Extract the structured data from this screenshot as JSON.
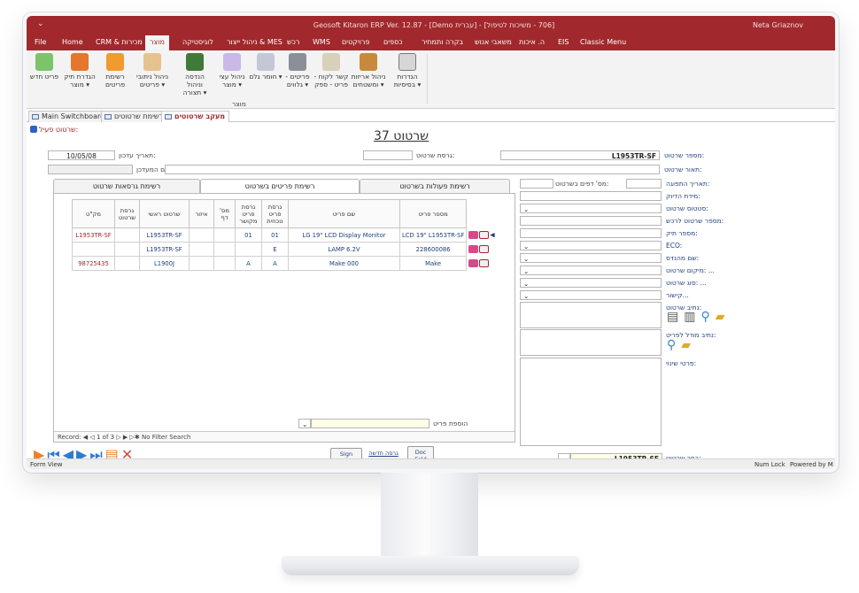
{
  "window": {
    "title": "Geosoft Kitaron ERP Ver. 12.87 - [Demo עברית] - [706 - משיכות לטיפול]",
    "user": "Neta Griaznov",
    "quick_access": "⌄"
  },
  "menu": [
    "File",
    "Home",
    "CRM & מכירות",
    "מוצר",
    "לוגיסטיקה",
    "ניהול ייצור & MES",
    "רכש",
    "WMS",
    "פרויקטים",
    "כספים",
    "בקרה ותמחיר",
    "משאבי אנוש",
    "ה. איכות",
    "EIS",
    "Classic Menu"
  ],
  "menu_active": "מוצר",
  "ribbon": {
    "buttons": [
      {
        "label": "פריט חדש"
      },
      {
        "label": "הגדרת תיק מוצר ▾"
      },
      {
        "label": "רשימת פריטים"
      },
      {
        "label": "ניהול ניתובי פריטים ▾"
      },
      {
        "label": "הנדסה וניהול תצורה ▾"
      },
      {
        "label": "ניהול עצי מוצר ▾"
      },
      {
        "label": "חומר גלם ▾"
      },
      {
        "label": "פריטים - גלווים ▾"
      },
      {
        "label": "קשר לקוח - פריט - ספק"
      },
      {
        "label": "ניהול אריזות ומשטחים ▾"
      },
      {
        "label": "הגדרות בסיסיות ▾"
      }
    ],
    "group_label": "מוצר"
  },
  "doc_tabs": [
    "Main Switchboard",
    "רשימת שרטוטים",
    "מעקב שרטוטים"
  ],
  "form": {
    "title": "שרטוט 37",
    "active_label": "שרטוט פעיל:",
    "update_date_label": "תאריך עדכון:",
    "update_date": "10/05/08",
    "updater_label": "שם המעדכן:",
    "updater": "",
    "version_label": "גרסת שרטוט:",
    "version": "",
    "drawing_no_label": "מספר שרטוט:",
    "drawing_no": "L1953TR-SF",
    "description_label": "תאור שרטוט:",
    "description": "",
    "right_labels": [
      "תאריך התפוגה:",
      "מידת הדיוק:",
      "סטטוס שרטוט:",
      "מספר שרטוט לרכש:",
      "מספר תיק:",
      "ECO:",
      "שם מהנדס:",
      "מיקום שרטוט: ...",
      "סוג שרטוט: ...",
      "קישור..."
    ],
    "pages_label": "מס' דפים בשרטוט:",
    "path_label": "נתיב שרטוט:",
    "model_path_label": "נתיב מודל לפריט:",
    "change_details_label": "פרטי שינוי:",
    "select_drawing_label": "בחר שרטוט:",
    "select_drawing_value": "L1953TR-SF"
  },
  "grid_tabs": [
    "רשימת גרסאות שרטוט",
    "רשימת פריטים בשרטוט",
    "רשימת פעולות בשרטוט"
  ],
  "grid_tab_active": "רשימת פריטים בשרטוט",
  "grid": {
    "headers": [
      "מק\"ט",
      "גרסת שרטוט",
      "שרטוט ראשי",
      "איזור",
      "מס' דף",
      "גרסת פריט מקושר",
      "גרסת פריט נוכחית",
      "שם פריט",
      "מספר פריט"
    ],
    "rows": [
      [
        "L1953TR-SF",
        "",
        "L1953TR-SF",
        "",
        "",
        "01",
        "01",
        "LG 19\" LCD Display Monitor",
        "LCD 19\" L1953TR-SF"
      ],
      [
        "",
        "",
        "L1953TR-SF",
        "",
        "",
        "",
        "E",
        "LAMP 6.2V",
        "228600086"
      ],
      [
        "98725435",
        "",
        "L1900J",
        "",
        "",
        "A",
        "A",
        "Make 000",
        "Make"
      ]
    ],
    "add_item_label": "הוספת פריט",
    "record_bar": "Record: ◀ ◁ 1 of 3 ▷ ▶ ▷✱   No Filter   Search"
  },
  "buttons": {
    "sign": "Sign",
    "new_version": "גרסה חדשה",
    "doc_fold": "Doc Fold"
  },
  "status": {
    "left": "Form View",
    "num_lock": "Num Lock",
    "powered": "Powered by M"
  },
  "colors": {
    "brand": "#a1282c",
    "link": "#1f3f7a",
    "nav_blue": "#2d7bd1"
  }
}
